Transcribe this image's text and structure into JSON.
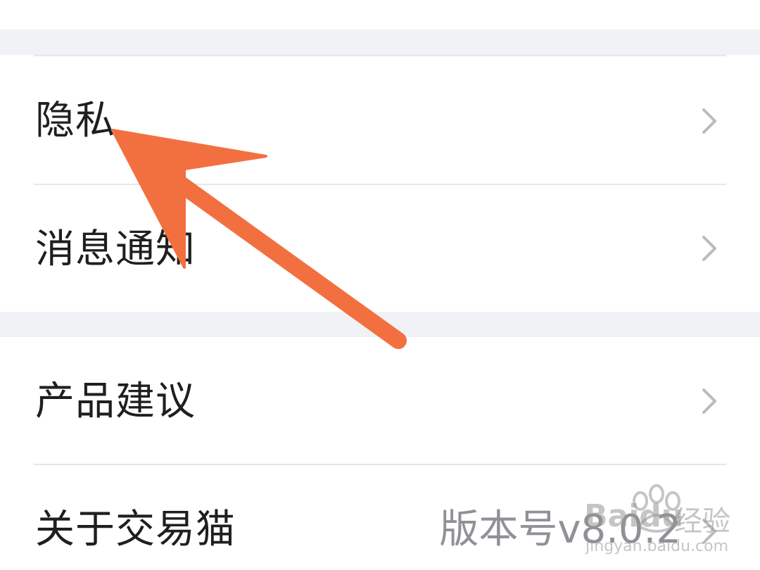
{
  "settings": {
    "items": [
      {
        "label": "隐私",
        "value": ""
      },
      {
        "label": "消息通知",
        "value": ""
      },
      {
        "label": "产品建议",
        "value": ""
      },
      {
        "label": "关于交易猫",
        "value": "版本号v8.0.2"
      }
    ]
  },
  "watermark": {
    "brand": "Baidu",
    "brand_cn": "经验",
    "url": "jingyan.baidu.com"
  },
  "colors": {
    "background": "#ffffff",
    "section_gap": "#f1f2f5",
    "label": "#1f1f1f",
    "secondary_text": "#8f9196",
    "chevron": "#b9bbc0",
    "divider": "#e6e7ea",
    "annotation_arrow": "#f2703f"
  },
  "icons": {
    "row_chevron": "chevron-right-icon",
    "annotation": "annotation-arrow-icon"
  }
}
